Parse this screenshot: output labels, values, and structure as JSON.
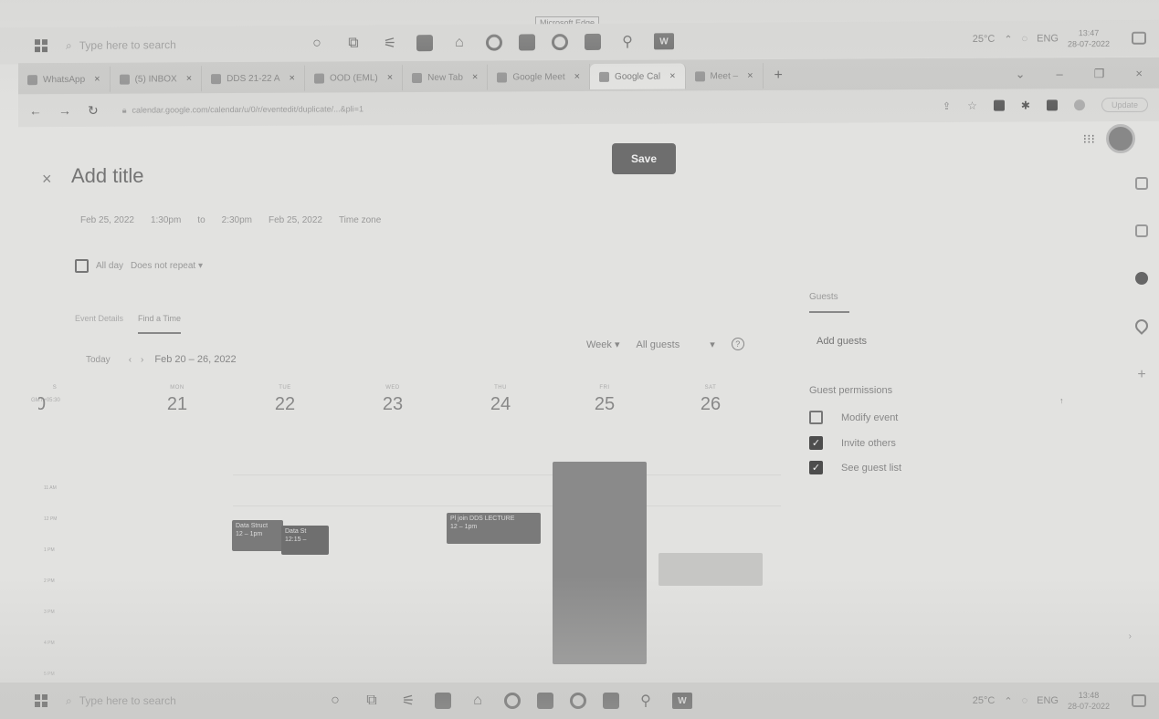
{
  "os": {
    "search_placeholder": "Type here to search",
    "weather": "25°C",
    "lang": "ENG",
    "top_time": "13:47",
    "top_date": "28-07-2022",
    "bottom_time": "13:48",
    "bottom_date": "28-07-2022",
    "edge_tooltip": "Microsoft Edge"
  },
  "browser": {
    "tabs": [
      {
        "label": "WhatsApp"
      },
      {
        "label": "(5) INBOX"
      },
      {
        "label": "DDS 21-22 A"
      },
      {
        "label": "OOD (EML)"
      },
      {
        "label": "New Tab"
      },
      {
        "label": "Google Meet"
      },
      {
        "label": "Google Cal",
        "active": true
      },
      {
        "label": "Meet –"
      }
    ],
    "url": "calendar.google.com/calendar/u/0/r/eventedit/duplicate/...&pli=1",
    "update_label": "Update"
  },
  "event": {
    "title_placeholder": "Add title",
    "save_label": "Save",
    "start_date": "Feb 25, 2022",
    "start_time": "1:30pm",
    "to": "to",
    "end_time": "2:30pm",
    "end_date": "Feb 25, 2022",
    "time_zone": "Time zone",
    "all_day": "All day",
    "repeat": "Does not repeat"
  },
  "tabs": {
    "details": "Event Details",
    "find_time": "Find a Time"
  },
  "calendar": {
    "today": "Today",
    "range": "Feb 20 – 26, 2022",
    "view": "Week",
    "guests_filter": "All guests",
    "tz": "GMT+05:30",
    "days": [
      {
        "dow": "S",
        "num": "20"
      },
      {
        "dow": "MON",
        "num": "21"
      },
      {
        "dow": "TUE",
        "num": "22"
      },
      {
        "dow": "WED",
        "num": "23"
      },
      {
        "dow": "THU",
        "num": "24"
      },
      {
        "dow": "FRI",
        "num": "25"
      },
      {
        "dow": "SAT",
        "num": "26"
      }
    ],
    "hours": [
      "11 AM",
      "12 PM",
      "1 PM",
      "2 PM",
      "3 PM",
      "4 PM",
      "5 PM"
    ],
    "events": [
      {
        "label": "Data Struct",
        "time": "12 – 1pm"
      },
      {
        "label": "Data St",
        "time": "12:15 –"
      },
      {
        "label": "Pl join DDS LECTURE",
        "time": "12 – 1pm"
      }
    ]
  },
  "guests": {
    "tab_label": "Guests",
    "add_placeholder": "Add guests",
    "permissions_title": "Guest permissions",
    "modify": "Modify event",
    "invite": "Invite others",
    "see_list": "See guest list"
  }
}
